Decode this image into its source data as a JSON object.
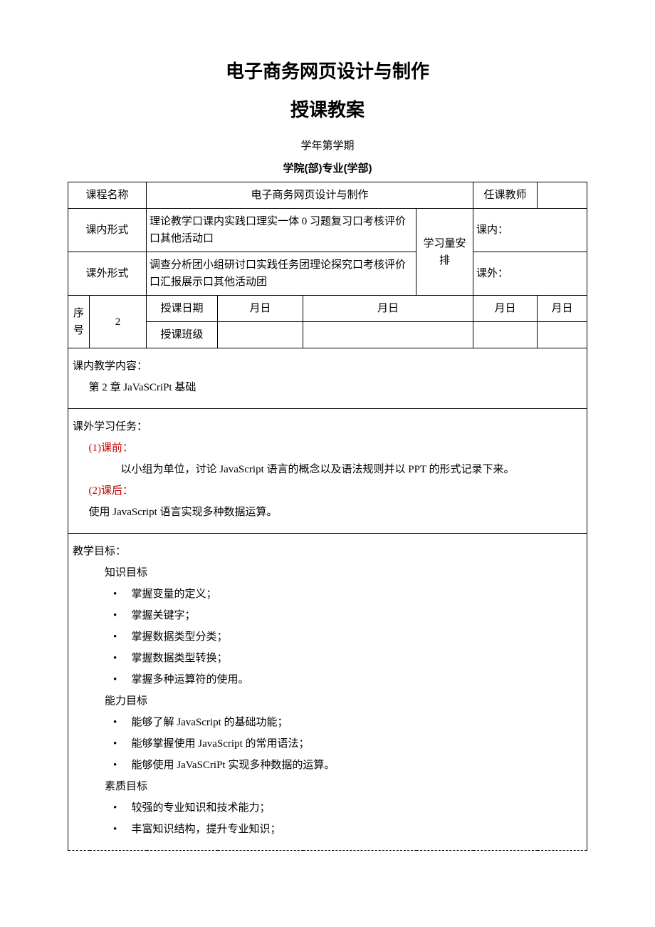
{
  "title1": "电子商务网页设计与制作",
  "title2": "授课教案",
  "semester_line": "学年第学期",
  "college_line": "学院(部)专业(学部)",
  "table": {
    "course_name_label": "课程名称",
    "course_name_value": "电子商务网页设计与制作",
    "teacher_label": "任课教师",
    "teacher_value": "",
    "inclass_form_label": "课内形式",
    "inclass_form_value": "理论教学口课内实践口理实一体 0 习题复习口考核评价口其他活动口",
    "study_arrange_label": "学习量安排",
    "inclass_label": "课内：",
    "outclass_form_label": "课外形式",
    "outclass_form_value": "调查分析团小组研讨口实践任务团理论探究口考核评价口汇报展示口其他活动团",
    "outclass_label": "课外：",
    "seq_label": "序号",
    "seq_value": "2",
    "teach_date_label": "授课日期",
    "teach_class_label": "授课班级",
    "date_cell": "月日"
  },
  "section1": {
    "heading": "课内教学内容：",
    "content": "第 2 章 JaVaSCriPt 基础"
  },
  "section2": {
    "heading": "课外学习任务：",
    "pre_label": "(1)课前：",
    "pre_content": "以小组为单位，讨论 JavaScript 语言的概念以及语法规则并以 PPT 的形式记录下来。",
    "post_label": "(2)课后：",
    "post_content": "使用 JavaScript 语言实现多种数据运算。"
  },
  "section3": {
    "heading": "教学目标：",
    "knowledge_label": "知识目标",
    "knowledge_items": [
      "掌握变量的定义；",
      "掌握关键字；",
      "掌握数据类型分类；",
      "掌握数据类型转换；",
      "掌握多种运算符的使用。"
    ],
    "ability_label": "能力目标",
    "ability_items": [
      "能够了解 JavaScript 的基础功能；",
      "能够掌握使用 JavaScript 的常用语法；",
      "能够使用 JaVaSCriPt 实现多种数据的运算。"
    ],
    "quality_label": "素质目标",
    "quality_items": [
      "较强的专业知识和技术能力；",
      "丰富知识结构，提升专业知识；"
    ]
  }
}
